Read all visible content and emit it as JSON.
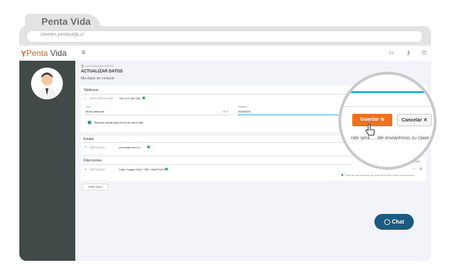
{
  "browser": {
    "tab_title": "Penta Vida",
    "url": "clientes.pentavida.cl"
  },
  "header": {
    "logo_mark": "Y",
    "logo_prefix": "Penta",
    "logo_suffix": " Vida",
    "menu_icon": "hamburger-icon",
    "icons": [
      "id-card-icon",
      "key-icon",
      "power-icon"
    ]
  },
  "page": {
    "breadcrumb": "🏠 / ACTUALIZAR DATOS",
    "title": "ACTUALIZAR DATOS",
    "subtitle": "Mis datos de contacto"
  },
  "phone": {
    "section": "Teléfonos",
    "type": "MÓVIL PARTICULAR",
    "value": "+56 9 92 000 000",
    "type_label": "Tipo",
    "type_value": "Móvil particular",
    "prefix": "+ 56 9",
    "number_label": "Número",
    "number_value": "00000000",
    "checkbox_label": "Teléfono actual para envío de clave web"
  },
  "email": {
    "section": "Emails",
    "type": "PARTICULAR",
    "value": "correo@correo.cl"
  },
  "address": {
    "section": "Direcciones",
    "type": "PARTICULAR",
    "value": "Calle Yungay 2816 / 305 / SANTIAGO",
    "add_label": "Agregar",
    "note": "Todas las comunicaciones que recibe Penta Vida se harán a esta dirección"
  },
  "actions": {
    "add_email": "Añadir correo",
    "save": "Guardar",
    "cancel": "Cancelar",
    "lens_text": "ndo será…..ide enviaremos su clave w"
  },
  "chat": {
    "label": "Chat"
  },
  "colors": {
    "accent": "#f07021",
    "sidebar": "#414a48",
    "chat": "#1d5a80",
    "teal": "#2aa6a1"
  }
}
